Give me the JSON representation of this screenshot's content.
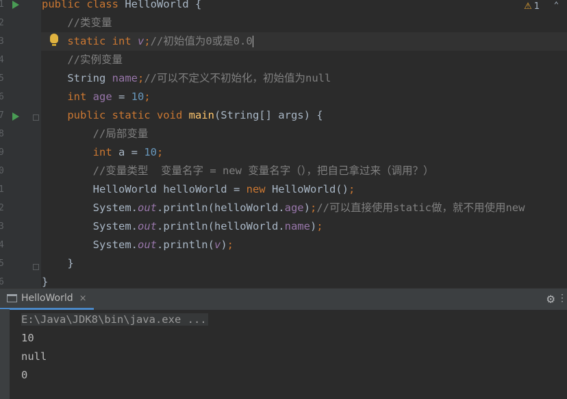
{
  "editor": {
    "line_numbers": [
      "1",
      "2",
      "3",
      "4",
      "5",
      "6",
      "7",
      "8",
      "9",
      "0",
      "1",
      "2",
      "3",
      "4",
      "5",
      "6"
    ],
    "warnings_count": "1",
    "warning_icon": "⚠",
    "lines": [
      [
        [
          "kw",
          "public class "
        ],
        [
          "",
          "HelloWorld {"
        ]
      ],
      [
        [
          "cm",
          "    //类变量"
        ]
      ],
      [
        [
          "kw",
          "    static int "
        ],
        [
          "ital",
          "v"
        ],
        [
          "kw",
          ";"
        ],
        [
          "cm",
          "//初始值为0或是0.0"
        ]
      ],
      [
        [
          "cm",
          "    //实例变量"
        ]
      ],
      [
        [
          "",
          "    String "
        ],
        [
          "fld",
          "name"
        ],
        [
          "kw",
          ";"
        ],
        [
          "cm",
          "//可以不定义不初始化，初始值为null"
        ]
      ],
      [
        [
          "kw",
          "    int "
        ],
        [
          "fld",
          "age "
        ],
        [
          "",
          "= "
        ],
        [
          "num",
          "10"
        ],
        [
          "kw",
          ";"
        ]
      ],
      [
        [
          "kw",
          "    public static void "
        ],
        [
          "fn",
          "main"
        ],
        [
          "",
          "(String[] args) {"
        ]
      ],
      [
        [
          "cm",
          "        //局部变量"
        ]
      ],
      [
        [
          "kw",
          "        int "
        ],
        [
          "",
          "a = "
        ],
        [
          "num",
          "10"
        ],
        [
          "kw",
          ";"
        ]
      ],
      [
        [
          "cm",
          "        //变量类型  变量名字 = new 变量名字（），把自己拿过来（调用？）"
        ]
      ],
      [
        [
          "",
          "        HelloWorld helloWorld = "
        ],
        [
          "kw",
          "new "
        ],
        [
          "",
          "HelloWorld()"
        ],
        [
          "kw",
          ";"
        ]
      ],
      [
        [
          "",
          "        System."
        ],
        [
          "ital",
          "out"
        ],
        [
          "",
          ".println(helloWorld."
        ],
        [
          "fld",
          "age"
        ],
        [
          "",
          ")"
        ],
        [
          "kw",
          ";"
        ],
        [
          "cm",
          "//可以直接使用static做，就不用使用new"
        ]
      ],
      [
        [
          "",
          "        System."
        ],
        [
          "ital",
          "out"
        ],
        [
          "",
          ".println(helloWorld."
        ],
        [
          "fld",
          "name"
        ],
        [
          "",
          ")"
        ],
        [
          "kw",
          ";"
        ]
      ],
      [
        [
          "",
          "        System."
        ],
        [
          "ital",
          "out"
        ],
        [
          "",
          ".println("
        ],
        [
          "ital",
          "v"
        ],
        [
          "",
          ")"
        ],
        [
          "kw",
          ";"
        ]
      ],
      [
        [
          "",
          "    }"
        ]
      ],
      [
        [
          "",
          "}"
        ]
      ]
    ]
  },
  "run": {
    "tab_label": "HelloWorld",
    "close_glyph": "×",
    "gear_glyph": "⚙",
    "more_glyph": "⋮",
    "command": "E:\\Java\\JDK8\\bin\\java.exe ...",
    "output": [
      "10",
      "null",
      "0"
    ]
  },
  "colors": {
    "background": "#2b2b2b",
    "keyword": "#cc7832",
    "comment": "#808080",
    "number": "#6897bb",
    "field": "#9876aa",
    "method": "#ffc66d",
    "run_green": "#499c54"
  }
}
